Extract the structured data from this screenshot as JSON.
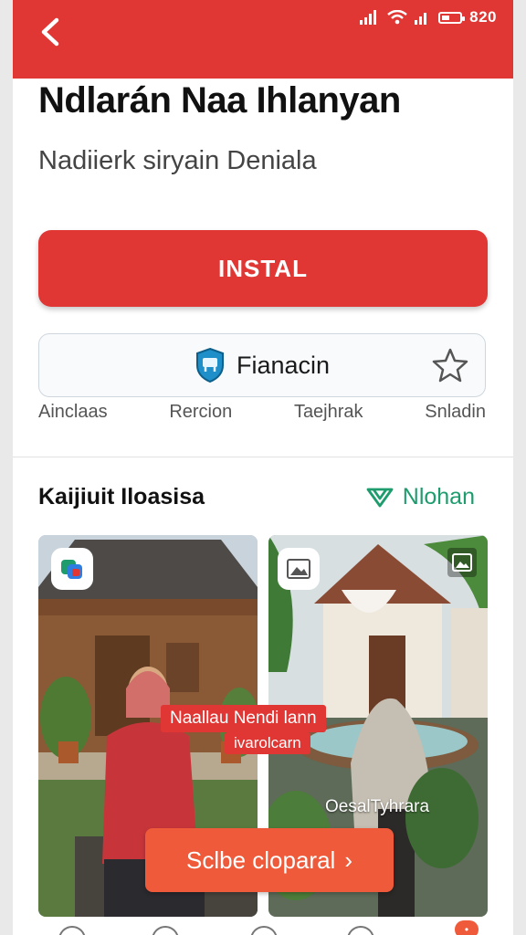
{
  "status_bar": {
    "time": "820"
  },
  "app": {
    "title": "Ndlarán Naa Ihlanyan",
    "subtitle": "Nadiierk siryain Deniala",
    "install_label": "INSTAL",
    "publisher_label": "Fianacin",
    "meta": [
      "Ainclaas",
      "Rercion",
      "Taejhrak",
      "Snladin"
    ]
  },
  "section": {
    "title": "Kaijiuit Iloasisa",
    "see_more": "Nlohan"
  },
  "cards": [
    {
      "overlay_tag": "Naallau Nendi lann",
      "overlay_tag2": "ivarolcarn"
    },
    {
      "caption": "OesalTyhrara"
    }
  ],
  "cta": {
    "label": "Sclbe cloparal",
    "arrow": "›"
  },
  "colors": {
    "accent": "#e03634",
    "green": "#1e9c6d",
    "cta": "#ef5a3a"
  },
  "icons": [
    "back-arrow-icon",
    "signal-icon",
    "wifi-icon",
    "battery-icon",
    "shield-icon",
    "star-icon",
    "heart-outline-icon",
    "app-badge-icon",
    "image-icon"
  ]
}
